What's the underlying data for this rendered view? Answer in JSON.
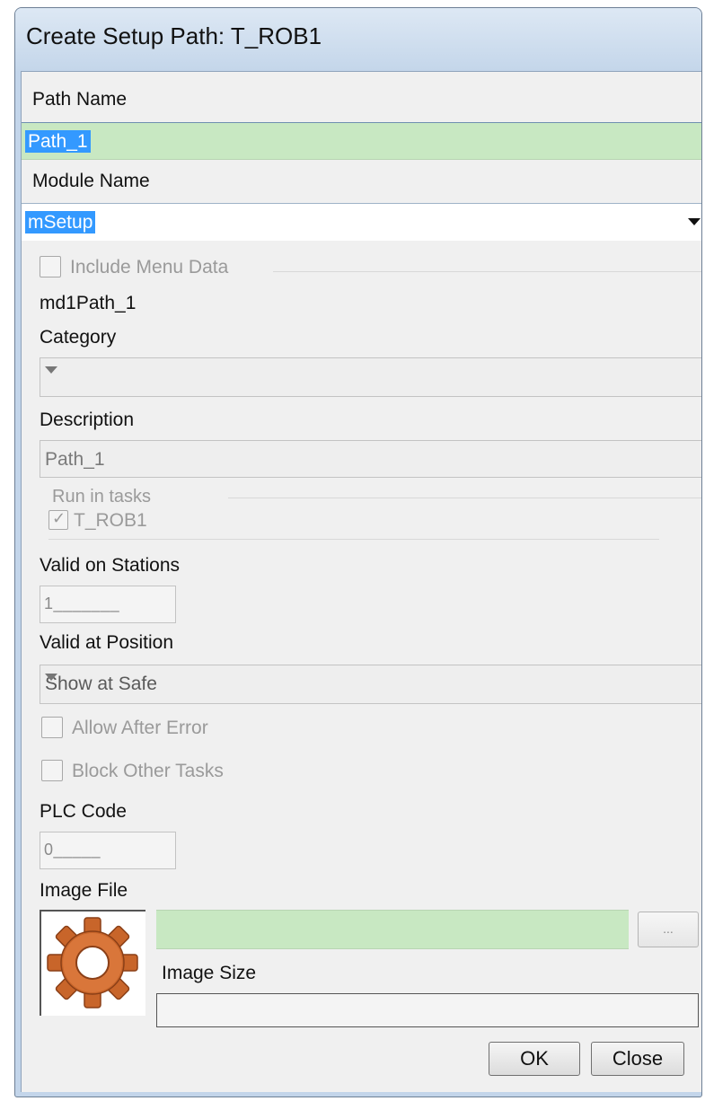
{
  "window": {
    "title": "Create Setup Path: T_ROB1"
  },
  "path_name": {
    "label": "Path Name",
    "value": "Path_1"
  },
  "module_name": {
    "label": "Module Name",
    "value": "mSetup"
  },
  "include_menu_data": {
    "label": "Include Menu Data",
    "checked": false,
    "enabled": false
  },
  "menu_data_name": "md1Path_1",
  "category": {
    "label": "Category",
    "value": ""
  },
  "description": {
    "label": "Description",
    "value": "Path_1"
  },
  "run_in_tasks": {
    "label": "Run in tasks",
    "task": "T_ROB1",
    "checked": true
  },
  "valid_on_stations": {
    "label": "Valid on Stations",
    "value": "1_______"
  },
  "valid_at_position": {
    "label": "Valid at Position",
    "value": "Show at Safe"
  },
  "allow_after_error": {
    "label": "Allow After Error",
    "checked": false
  },
  "block_other_tasks": {
    "label": "Block Other Tasks",
    "checked": false
  },
  "plc_code": {
    "label": "PLC Code",
    "value": "0_____"
  },
  "image_file": {
    "label": "Image File",
    "value": "",
    "icon": "gear-icon",
    "browse_label": "..."
  },
  "image_size": {
    "label": "Image Size",
    "value": ""
  },
  "buttons": {
    "ok": "OK",
    "close": "Close"
  },
  "colors": {
    "field_green": "#c8e8c2",
    "selection": "#3399ff",
    "gear": "#c8652a"
  }
}
